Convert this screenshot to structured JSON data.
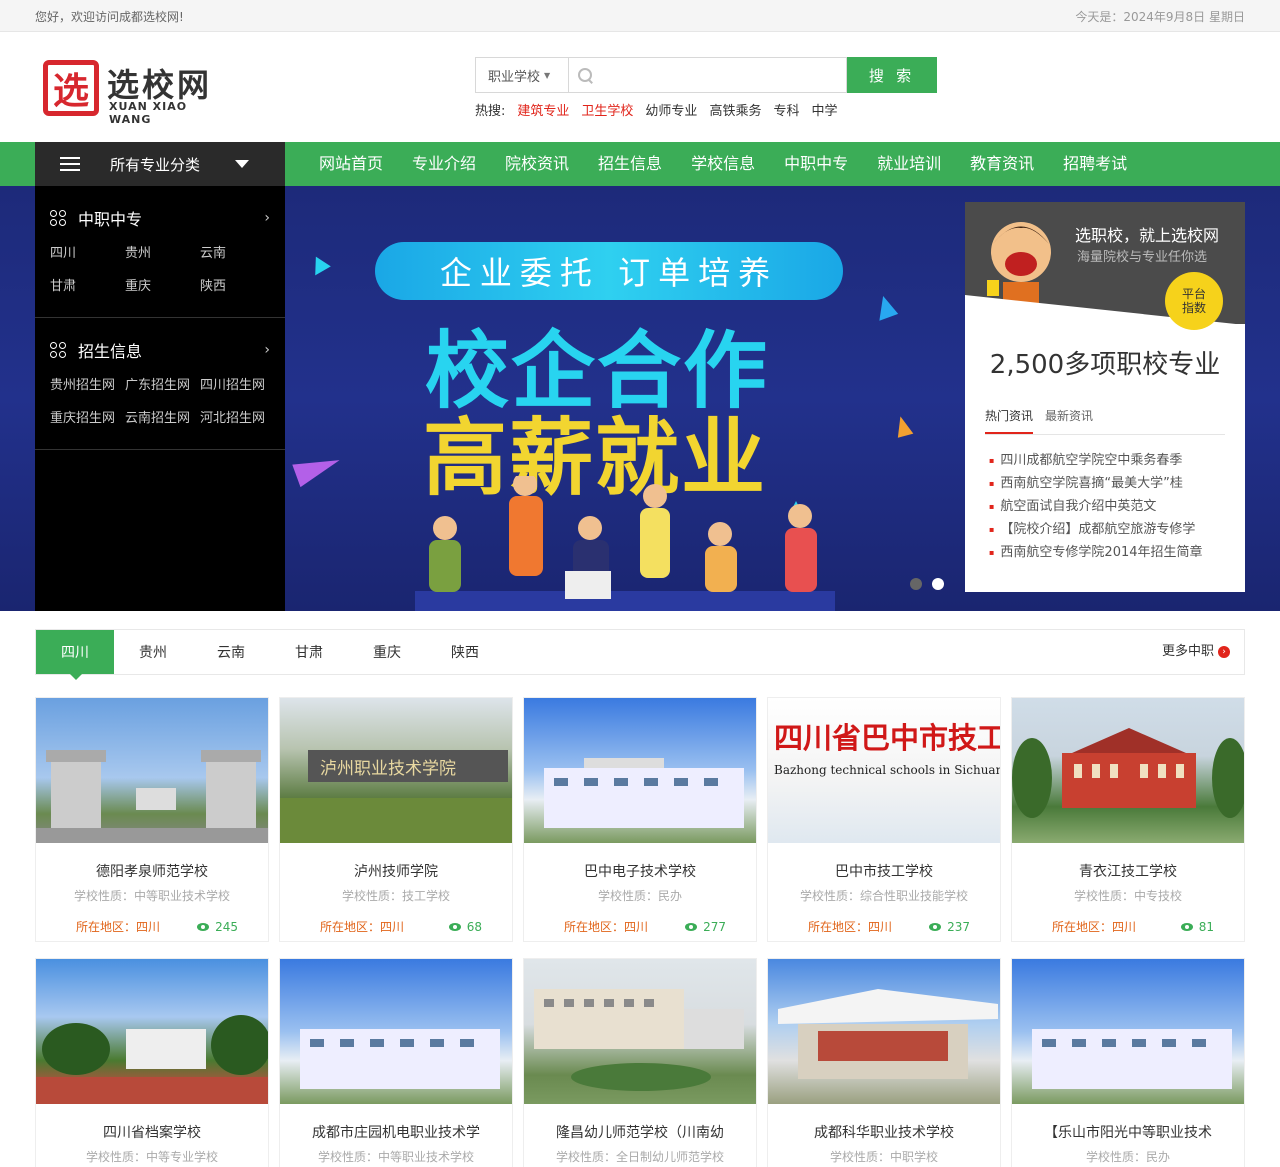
{
  "topbar": {
    "welcome": "您好，欢迎访问成都选校网!",
    "date": "今天是：2024年9月8日 星期日"
  },
  "logo": {
    "mark": "选",
    "cn": "选校网",
    "en": "XUAN XIAO WANG"
  },
  "search": {
    "category": "职业学校",
    "button": "搜 索",
    "placeholder": ""
  },
  "hot": {
    "label": "热搜:",
    "items": [
      {
        "text": "建筑专业",
        "red": true
      },
      {
        "text": "卫生学校",
        "red": true
      },
      {
        "text": "幼师专业",
        "red": false
      },
      {
        "text": "高铁乘务",
        "red": false
      },
      {
        "text": "专科",
        "red": false
      },
      {
        "text": "中学",
        "red": false
      }
    ]
  },
  "nav": {
    "all_label": "所有专业分类",
    "links": [
      "网站首页",
      "专业介绍",
      "院校资讯",
      "招生信息",
      "学校信息",
      "中职中专",
      "就业培训",
      "教育资讯",
      "招聘考试"
    ]
  },
  "side": {
    "sec1": {
      "title": "中职中专",
      "links": [
        "四川",
        "贵州",
        "云南",
        "甘肃",
        "重庆",
        "陕西"
      ]
    },
    "sec2": {
      "title": "招生信息",
      "links": [
        "贵州招生网",
        "广东招生网",
        "四川招生网",
        "重庆招生网",
        "云南招生网",
        "河北招生网"
      ]
    }
  },
  "banner": {
    "pill": "企业委托  订单培养",
    "line1": "校企合作",
    "line2": "高薪就业"
  },
  "right_card": {
    "title": "选职校，就上选校网",
    "subtitle": "海量院校与专业任你选",
    "badge": "平台\n指数",
    "badge_l1": "平台",
    "badge_l2": "指数",
    "count": "2,500多项职校专业",
    "tabs": [
      "热门资讯",
      "最新资讯"
    ],
    "news": [
      "四川成都航空学院空中乘务春季",
      "西南航空学院喜摘“最美大学”桂",
      "航空面试自我介绍中英范文",
      "【院校介绍】成都航空旅游专修学",
      "西南航空专修学院2014年招生简章"
    ]
  },
  "tabs": {
    "items": [
      "四川",
      "贵州",
      "云南",
      "甘肃",
      "重庆",
      "陕西"
    ],
    "more": "更多中职"
  },
  "schools": [
    {
      "name": "德阳孝泉师范学校",
      "type": "学校性质：中等职业技术学校",
      "loc": "所在地区：四川",
      "views": "245"
    },
    {
      "name": "泸州技师学院",
      "type": "学校性质：技工学校",
      "loc": "所在地区：四川",
      "views": "68"
    },
    {
      "name": "巴中电子技术学校",
      "type": "学校性质：民办",
      "loc": "所在地区：四川",
      "views": "277"
    },
    {
      "name": "巴中市技工学校",
      "type": "学校性质：综合性职业技能学校",
      "loc": "所在地区：四川",
      "views": "237"
    },
    {
      "name": "青衣江技工学校",
      "type": "学校性质：中专技校",
      "loc": "所在地区：四川",
      "views": "81"
    },
    {
      "name": "四川省档案学校",
      "type": "学校性质：中等专业学校",
      "loc": "",
      "views": ""
    },
    {
      "name": "成都市庄园机电职业技术学",
      "type": "学校性质：中等职业技术学校",
      "loc": "",
      "views": ""
    },
    {
      "name": "隆昌幼儿师范学校（川南幼",
      "type": "学校性质：全日制幼儿师范学校",
      "loc": "",
      "views": ""
    },
    {
      "name": "成都科华职业技术学校",
      "type": "学校性质：中职学校",
      "loc": "",
      "views": ""
    },
    {
      "name": "【乐山市阳光中等职业技术",
      "type": "学校性质：民办",
      "loc": "",
      "views": ""
    }
  ],
  "school4_sign": {
    "cn": "四川省巴中市技工学校",
    "en": "Bazhong technical schools in Sichuan Province"
  },
  "school2_sign": "泸州职业技术学院"
}
